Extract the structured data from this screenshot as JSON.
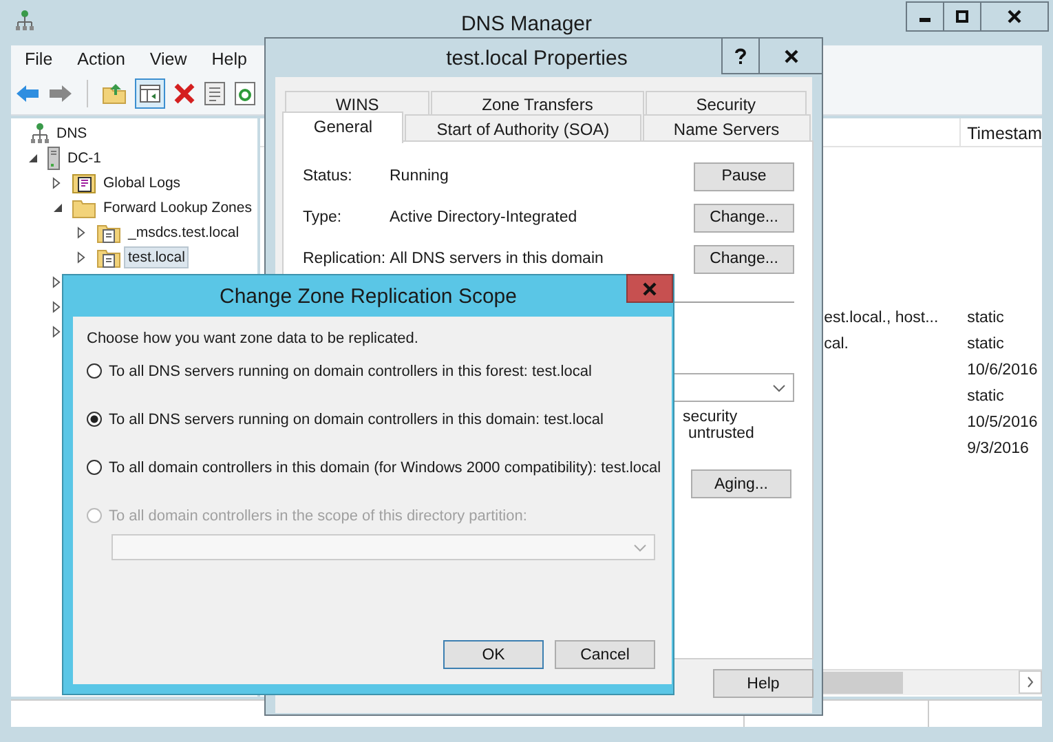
{
  "window": {
    "title": "DNS Manager"
  },
  "menu": [
    {
      "label": "File"
    },
    {
      "label": "Action"
    },
    {
      "label": "View"
    },
    {
      "label": "Help"
    }
  ],
  "tree": [
    {
      "label": "DNS",
      "kind": "root",
      "selected": false,
      "children": [
        {
          "label": "DC-1",
          "kind": "server",
          "expanded": true,
          "selected": false,
          "children": [
            {
              "label": "Global Logs",
              "kind": "log",
              "expanded": false,
              "selected": false
            },
            {
              "label": "Forward Lookup Zones",
              "kind": "folder",
              "expanded": true,
              "selected": false,
              "children": [
                {
                  "label": "_msdcs.test.local",
                  "kind": "zone",
                  "expanded": false,
                  "selected": false
                },
                {
                  "label": "test.local",
                  "kind": "zone",
                  "expanded": false,
                  "selected": true
                }
              ]
            },
            {
              "expanded": false
            },
            {
              "expanded": false
            },
            {
              "expanded": false
            }
          ]
        }
      ]
    }
  ],
  "list": {
    "header": "Timestam",
    "rows": [
      {
        "name": "est.local., host...",
        "timestamp": "static"
      },
      {
        "name": "cal.",
        "timestamp": "static"
      },
      {
        "timestamp": "10/6/2016"
      },
      {
        "timestamp": "static"
      },
      {
        "timestamp": "10/5/2016"
      },
      {
        "timestamp": "9/3/2016"
      }
    ]
  },
  "properties": {
    "title": "test.local Properties",
    "tab_rows": [
      [
        {
          "label": "WINS",
          "selected": false
        },
        {
          "label": "Zone Transfers",
          "selected": false
        },
        {
          "label": "Security",
          "selected": false
        }
      ],
      [
        {
          "label": "General",
          "selected": true
        },
        {
          "label": "Start of Authority (SOA)",
          "selected": false
        },
        {
          "label": "Name Servers",
          "selected": false
        }
      ]
    ],
    "fields": [
      {
        "label": "Status:",
        "value": "Running",
        "button": "Pause"
      },
      {
        "label": "Type:",
        "value": "Active Directory-Integrated",
        "button": "Change..."
      },
      {
        "label": "Replication:",
        "value": "All DNS servers in this domain",
        "button": "Change..."
      }
    ],
    "fragments": [
      "security",
      "untrusted"
    ],
    "aging_button": "Aging...",
    "help_button": "Help"
  },
  "scope_dialog": {
    "title": "Change Zone Replication Scope",
    "prompt": "Choose how you want zone data to be replicated.",
    "options": [
      {
        "label": "To all DNS servers running on domain controllers in this forest: test.local",
        "selected": false,
        "disabled": false
      },
      {
        "label": "To all DNS servers running on domain controllers in this domain: test.local",
        "selected": true,
        "disabled": false
      },
      {
        "label": "To all domain controllers in this domain (for Windows 2000 compatibility): test.local",
        "selected": false,
        "disabled": false
      },
      {
        "label": "To all domain controllers in the scope of this directory partition:",
        "selected": false,
        "disabled": true
      }
    ],
    "partition_dropdown": {
      "disabled": true
    },
    "buttons": [
      {
        "label": "OK",
        "default": true
      },
      {
        "label": "Cancel",
        "default": false
      }
    ]
  }
}
